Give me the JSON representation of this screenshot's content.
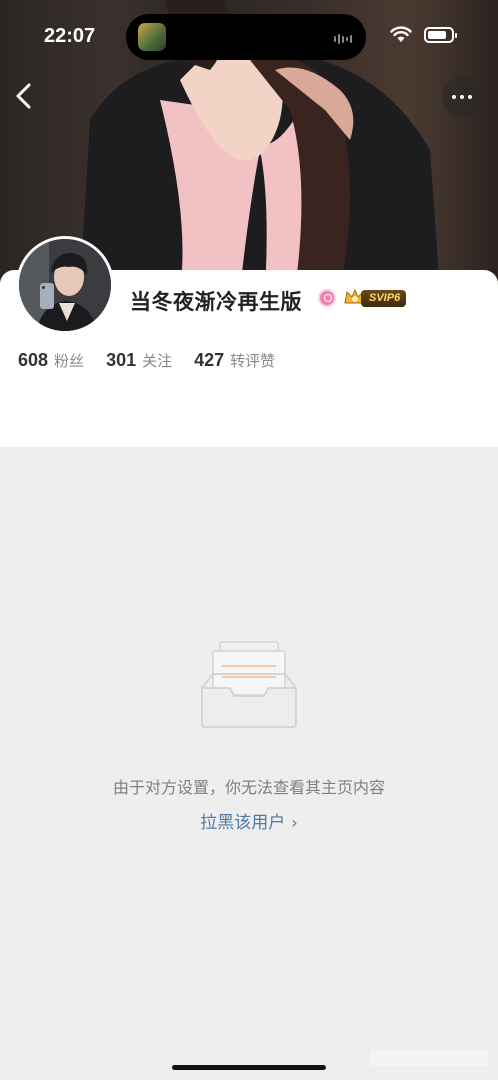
{
  "status_bar": {
    "time": "22:07",
    "battery_level": 0.8
  },
  "profile": {
    "nickname": "当冬夜渐冷再生版",
    "vip_level": "SVIP6",
    "stats": [
      {
        "count": "608",
        "label": "粉丝"
      },
      {
        "count": "301",
        "label": "关注"
      },
      {
        "count": "427",
        "label": "转评赞"
      }
    ]
  },
  "empty_state": {
    "message": "由于对方设置，你无法查看其主页内容",
    "block_link": "拉黑该用户",
    "block_link_chevron": "›"
  },
  "colors": {
    "link": "#4f7aa8",
    "background": "#eeeeee",
    "verify_badge": "#f37fb3",
    "vip_gold": "#ffd76a"
  },
  "icons": [
    "back-arrow-icon",
    "more-icon",
    "wifi-icon",
    "battery-icon",
    "verify-badge-icon",
    "vip-crown-icon",
    "empty-inbox-icon"
  ]
}
